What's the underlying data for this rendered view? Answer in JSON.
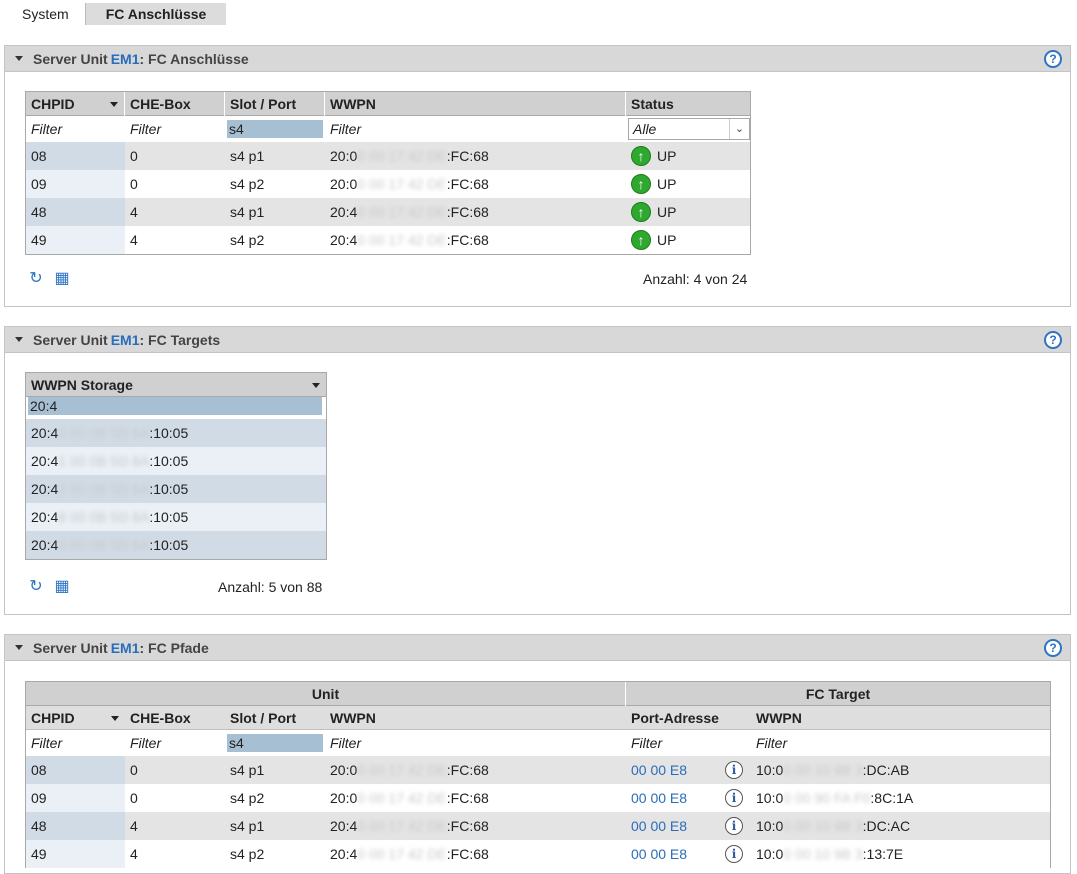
{
  "tabs": [
    {
      "label": "System",
      "active": false
    },
    {
      "label": "FC Anschlüsse",
      "active": true
    }
  ],
  "panel1": {
    "title_prefix": "Server Unit",
    "unit": "EM1",
    "title_suffix": ": FC Anschlüsse",
    "columns": [
      "CHPID",
      "CHE-Box",
      "Slot / Port",
      "WWPN",
      "Status"
    ],
    "filters": {
      "chpid": "Filter",
      "chebox": "Filter",
      "slot": "s4",
      "wwpn": "Filter",
      "status": "Alle"
    },
    "rows": [
      {
        "chpid": "08",
        "chebox": "0",
        "slot": "s4 p1",
        "wwpn_a": "20:0",
        "wwpn_b": "0 00 17 42 DE",
        "wwpn_c": ":FC:68",
        "status": "UP"
      },
      {
        "chpid": "09",
        "chebox": "0",
        "slot": "s4 p2",
        "wwpn_a": "20:0",
        "wwpn_b": "0 00 17 42 DE",
        "wwpn_c": ":FC:68",
        "status": "UP"
      },
      {
        "chpid": "48",
        "chebox": "4",
        "slot": "s4 p1",
        "wwpn_a": "20:4",
        "wwpn_b": "0 00 17 42 DE",
        "wwpn_c": ":FC:68",
        "status": "UP"
      },
      {
        "chpid": "49",
        "chebox": "4",
        "slot": "s4 p2",
        "wwpn_a": "20:4",
        "wwpn_b": "0 00 17 42 DE",
        "wwpn_c": ":FC:68",
        "status": "UP"
      }
    ],
    "count": "Anzahl: 4 von 24"
  },
  "panel2": {
    "title_prefix": "Server Unit",
    "unit": "EM1",
    "title_suffix": ": FC Targets",
    "column": "WWPN Storage",
    "filter": "20:4",
    "rows": [
      {
        "a": "20:4",
        "b": "0 00 0B 5D 6A",
        "c": ":10:05"
      },
      {
        "a": "20:4",
        "b": "1 00 0B 5D 6A",
        "c": ":10:05"
      },
      {
        "a": "20:4",
        "b": "2 00 0B 5D 6A",
        "c": ":10:05"
      },
      {
        "a": "20:4",
        "b": "8 00 0B 5D 6A",
        "c": ":10:05"
      },
      {
        "a": "20:4",
        "b": "9 00 0B 5D 6A",
        "c": ":10:05"
      }
    ],
    "count": "Anzahl: 5 von 88"
  },
  "panel3": {
    "title_prefix": "Server Unit",
    "unit": "EM1",
    "title_suffix": ": FC Pfade",
    "group_unit": "Unit",
    "group_target": "FC Target",
    "columns": [
      "CHPID",
      "CHE-Box",
      "Slot / Port",
      "WWPN",
      "Port-Adresse",
      "WWPN"
    ],
    "filters": {
      "chpid": "Filter",
      "chebox": "Filter",
      "slot": "s4",
      "wwpn": "Filter",
      "port": "Filter",
      "twwpn": "Filter"
    },
    "rows": [
      {
        "chpid": "08",
        "chebox": "0",
        "slot": "s4 p1",
        "wwpn_a": "20:0",
        "wwpn_b": "0 00 17 42 DE",
        "wwpn_c": ":FC:68",
        "port": "00 00 E8",
        "t_a": "10:0",
        "t_b": "0 00 10 9B 3",
        "t_c": ":DC:AB"
      },
      {
        "chpid": "09",
        "chebox": "0",
        "slot": "s4 p2",
        "wwpn_a": "20:0",
        "wwpn_b": "0 00 17 42 DE",
        "wwpn_c": ":FC:68",
        "port": "00 00 E8",
        "t_a": "10:0",
        "t_b": "0 00 90 FA F0",
        "t_c": ":8C:1A"
      },
      {
        "chpid": "48",
        "chebox": "4",
        "slot": "s4 p1",
        "wwpn_a": "20:4",
        "wwpn_b": "0 00 17 42 DE",
        "wwpn_c": ":FC:68",
        "port": "00 00 E8",
        "t_a": "10:0",
        "t_b": "0 00 10 9B 3",
        "t_c": ":DC:AC"
      },
      {
        "chpid": "49",
        "chebox": "4",
        "slot": "s4 p2",
        "wwpn_a": "20:4",
        "wwpn_b": "0 00 17 42 DE",
        "wwpn_c": ":FC:68",
        "port": "00 00 E8",
        "t_a": "10:0",
        "t_b": "0 00 10 9B 3",
        "t_c": ":13:7E"
      }
    ]
  },
  "icons": {
    "help": "help-icon",
    "refresh": "refresh-clock-icon",
    "export": "table-export-icon",
    "up": "arrow-up-status-icon",
    "info": "info-icon"
  },
  "colors": {
    "accent": "#2a6db8",
    "up_green": "#2fa82f",
    "filter_highlight": "#a7bfd3"
  }
}
